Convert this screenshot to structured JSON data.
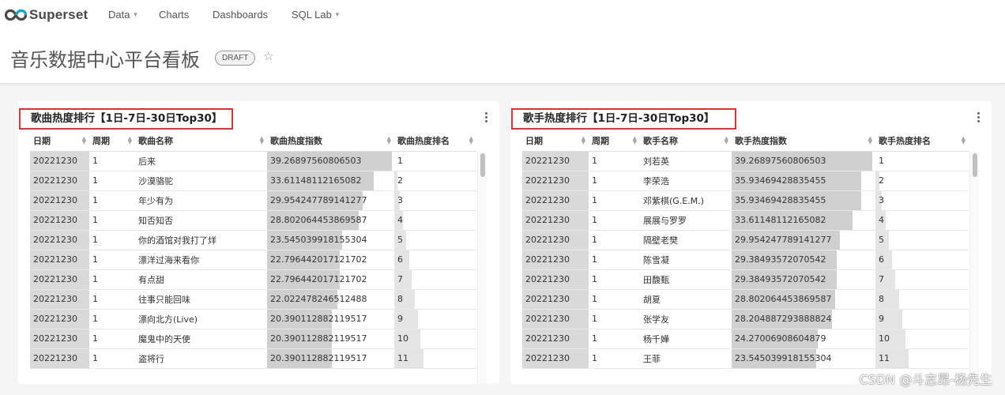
{
  "navbar": {
    "brand": "Superset",
    "menu": [
      {
        "label": "Data",
        "dropdown": true
      },
      {
        "label": "Charts",
        "dropdown": false
      },
      {
        "label": "Dashboards",
        "dropdown": false
      },
      {
        "label": "SQL Lab",
        "dropdown": true
      }
    ]
  },
  "dashboard": {
    "title": "音乐数据中心平台看板",
    "status": "DRAFT",
    "favorite_icon": "star-icon"
  },
  "charts": [
    {
      "title": "歌曲热度排行【1日-7日-30日Top30】",
      "columns": [
        "日期",
        "周期",
        "歌曲名称",
        "歌曲热度指数",
        "歌曲热度排名"
      ],
      "rows": [
        {
          "date": "20221230",
          "period": "1",
          "name": "后来",
          "score": "39.26897560806503",
          "rank": "1",
          "score_ratio": 0.98,
          "rank_ratio": 0.0
        },
        {
          "date": "20221230",
          "period": "1",
          "name": "沙漠骆驼",
          "score": "33.61148112165082",
          "rank": "2",
          "score_ratio": 0.84,
          "rank_ratio": 0.04
        },
        {
          "date": "20221230",
          "period": "1",
          "name": "年少有为",
          "score": "29.954247789141277",
          "rank": "3",
          "score_ratio": 0.75,
          "rank_ratio": 0.07
        },
        {
          "date": "20221230",
          "period": "1",
          "name": "知否知否",
          "score": "28.802064453869587",
          "rank": "4",
          "score_ratio": 0.72,
          "rank_ratio": 0.11
        },
        {
          "date": "20221230",
          "period": "1",
          "name": "你的酒馆对我打了烊",
          "score": "23.545039918155304",
          "rank": "5",
          "score_ratio": 0.59,
          "rank_ratio": 0.14
        },
        {
          "date": "20221230",
          "period": "1",
          "name": "漂洋过海来看你",
          "score": "22.796442017121702",
          "rank": "6",
          "score_ratio": 0.57,
          "rank_ratio": 0.18
        },
        {
          "date": "20221230",
          "period": "1",
          "name": "有点甜",
          "score": "22.796442017121702",
          "rank": "7",
          "score_ratio": 0.57,
          "rank_ratio": 0.21
        },
        {
          "date": "20221230",
          "period": "1",
          "name": "往事只能回味",
          "score": "22.022478246512488",
          "rank": "8",
          "score_ratio": 0.55,
          "rank_ratio": 0.25
        },
        {
          "date": "20221230",
          "period": "1",
          "name": "漂向北方(Live)",
          "score": "20.390112882119517",
          "rank": "9",
          "score_ratio": 0.51,
          "rank_ratio": 0.29
        },
        {
          "date": "20221230",
          "period": "1",
          "name": "魔鬼中的天使",
          "score": "20.390112882119517",
          "rank": "10",
          "score_ratio": 0.51,
          "rank_ratio": 0.32
        },
        {
          "date": "20221230",
          "period": "1",
          "name": "盗将行",
          "score": "20.390112882119517",
          "rank": "11",
          "score_ratio": 0.51,
          "rank_ratio": 0.36
        }
      ]
    },
    {
      "title": "歌手热度排行【1日-7日-30日Top30】",
      "columns": [
        "日期",
        "周期",
        "歌手名称",
        "歌手热度指数",
        "歌手热度排名"
      ],
      "rows": [
        {
          "date": "20221230",
          "period": "1",
          "name": "刘若英",
          "score": "39.26897560806503",
          "rank": "1",
          "score_ratio": 0.98,
          "rank_ratio": 0.0
        },
        {
          "date": "20221230",
          "period": "1",
          "name": "李荣浩",
          "score": "35.93469428835455",
          "rank": "2",
          "score_ratio": 0.9,
          "rank_ratio": 0.04
        },
        {
          "date": "20221230",
          "period": "1",
          "name": "邓紫棋(G.E.M.)",
          "score": "35.93469428835455",
          "rank": "3",
          "score_ratio": 0.9,
          "rank_ratio": 0.07
        },
        {
          "date": "20221230",
          "period": "1",
          "name": "展展与罗罗",
          "score": "33.61148112165082",
          "rank": "4",
          "score_ratio": 0.84,
          "rank_ratio": 0.11
        },
        {
          "date": "20221230",
          "period": "1",
          "name": "隔壁老樊",
          "score": "29.954247789141277",
          "rank": "5",
          "score_ratio": 0.75,
          "rank_ratio": 0.14
        },
        {
          "date": "20221230",
          "period": "1",
          "name": "陈雪凝",
          "score": "29.38493572070542",
          "rank": "6",
          "score_ratio": 0.73,
          "rank_ratio": 0.18
        },
        {
          "date": "20221230",
          "period": "1",
          "name": "田馥甄",
          "score": "29.38493572070542",
          "rank": "7",
          "score_ratio": 0.73,
          "rank_ratio": 0.21
        },
        {
          "date": "20221230",
          "period": "1",
          "name": "胡夏",
          "score": "28.802064453869587",
          "rank": "8",
          "score_ratio": 0.72,
          "rank_ratio": 0.25
        },
        {
          "date": "20221230",
          "period": "1",
          "name": "张学友",
          "score": "28.204887293888824",
          "rank": "9",
          "score_ratio": 0.7,
          "rank_ratio": 0.29
        },
        {
          "date": "20221230",
          "period": "1",
          "name": "杨千嬅",
          "score": "24.27006908604879",
          "rank": "10",
          "score_ratio": 0.6,
          "rank_ratio": 0.32
        },
        {
          "date": "20221230",
          "period": "1",
          "name": "王菲",
          "score": "23.545039918155304",
          "rank": "11",
          "score_ratio": 0.59,
          "rank_ratio": 0.36
        }
      ]
    }
  ],
  "watermark": "CSDN @斗志昂-杨先生"
}
